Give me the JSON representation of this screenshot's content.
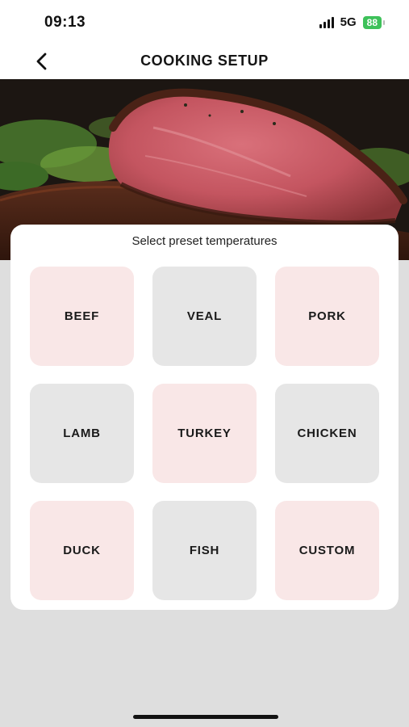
{
  "status": {
    "time": "09:13",
    "network": "5G",
    "battery": "88"
  },
  "header": {
    "title": "COOKING SETUP"
  },
  "panel": {
    "title": "Select preset temperatures",
    "presets": [
      "BEEF",
      "VEAL",
      "PORK",
      "LAMB",
      "TURKEY",
      "CHICKEN",
      "DUCK",
      "FISH",
      "CUSTOM"
    ]
  },
  "colors": {
    "pink_tile": "#f9e7e7",
    "gray_tile": "#e6e6e6",
    "battery": "#3ec15a",
    "background": "#dedede"
  }
}
